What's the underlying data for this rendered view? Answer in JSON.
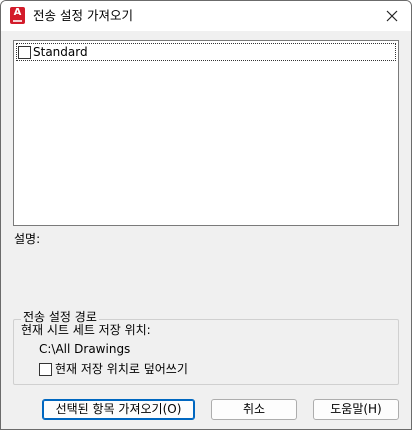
{
  "window": {
    "title": "전송 설정 가져오기",
    "icon": "autocad-app-icon",
    "icon_letter": "A",
    "accent": "#d31c2b"
  },
  "list": {
    "items": [
      {
        "label": "Standard",
        "checked": false
      }
    ]
  },
  "description": {
    "label": "설명:"
  },
  "path_group": {
    "legend": "전송 설정 경로",
    "location_label": "현재 시트 세트 저장 위치:",
    "location_value": "C:\\All Drawings",
    "overwrite_label": "현재 저장 위치로 덮어쓰기",
    "overwrite_checked": false
  },
  "buttons": {
    "import": "선택된 항목 가져오기(O)",
    "cancel": "취소",
    "help": "도움말(H)"
  }
}
